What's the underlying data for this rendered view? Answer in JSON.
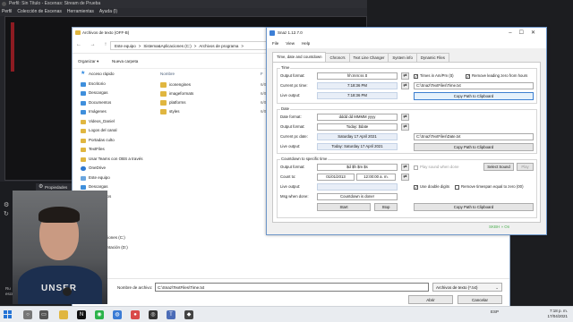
{
  "obs": {
    "title": "Perfil: Sin Título - Escenas: Stream de Prueba",
    "menu": [
      "Perfil",
      "Colección de Escenas",
      "Herramientas",
      "Ayuda (I)"
    ],
    "scene_bar_label": "Propiedades",
    "bottom_text": [
      "Ru",
      "escribir_..."
    ]
  },
  "webcam": {
    "shirt_text": "UNSER"
  },
  "explorer": {
    "title": "Archivos de texto (OFF-B)",
    "breadcrumb": [
      "Este equipo",
      ">",
      "Sistema&Aplicaciones (C:)",
      ">",
      "Archivos de programa",
      ">"
    ],
    "toolbar": {
      "organize": "Organizar ▾",
      "new_folder": "Nueva carpeta"
    },
    "sidebar": [
      {
        "label": "Acceso rápido",
        "icon": "star-icon"
      },
      {
        "label": "Escritorio",
        "icon": "folder-blue-icon"
      },
      {
        "label": "Descargas",
        "icon": "download-icon"
      },
      {
        "label": "Documentos",
        "icon": "document-icon"
      },
      {
        "label": "Imágenes",
        "icon": "image-icon"
      },
      {
        "label": "Videos_Daniel",
        "icon": "folder-icon"
      },
      {
        "label": "Logos del canal",
        "icon": "folder-icon"
      },
      {
        "label": "Portadas culto",
        "icon": "folder-icon"
      },
      {
        "label": "TextFiles",
        "icon": "folder-icon"
      },
      {
        "label": "Usar Teams con OBS a través",
        "icon": "folder-icon"
      },
      {
        "label": "OneDrive",
        "icon": "cloud-icon"
      },
      {
        "label": "Este equipo",
        "icon": "pc-icon"
      },
      {
        "label": "Descargas",
        "icon": "download-icon"
      },
      {
        "label": "Documentos",
        "icon": "document-icon"
      },
      {
        "label": "Escritorio",
        "icon": "folder-blue-icon"
      }
    ],
    "sidebar_lower": [
      {
        "label": "3D",
        "icon": "folder-icon"
      },
      {
        "label": "...&Aplicaciones (C:)",
        "icon": "drive-icon"
      },
      {
        "label": "...Documentación (D:)",
        "icon": "drive-icon"
      }
    ],
    "columns": {
      "name": "Nombre",
      "date": "F"
    },
    "files": [
      {
        "name": "iconengines",
        "date": "6/0"
      },
      {
        "name": "imageformats",
        "date": "6/0"
      },
      {
        "name": "platforms",
        "date": "6/0"
      },
      {
        "name": "styles",
        "date": "6/0"
      }
    ],
    "footer": {
      "filename_label": "Nombre de archivo:",
      "filename_value": "C:\\Snaz\\TextFiles\\Time.txt",
      "filetype": "Archivos de texto (*.txt)",
      "open": "Abrir",
      "cancel": "Cancelar"
    }
  },
  "snaz": {
    "title": "Snaz 1.12.7.0",
    "menu": [
      "File",
      "View",
      "Help"
    ],
    "tabs": [
      "Time, date and countdown",
      "Chrono's",
      "Text Line Changer",
      "System info",
      "Dynamic Files"
    ],
    "time": {
      "group": "Time",
      "output_format_label": "Output format:",
      "output_format": "hh:mm:ss tt",
      "current_label": "Current pc time:",
      "current": "7:18:36 PM",
      "live_label": "Live output:",
      "live": "7:18:36 PM",
      "chk_ampm": "Times in Am/Pm (tt)",
      "chk_zero": "Remove leading zero from hours",
      "path": "C:\\Snaz\\TextFiles\\Time.txt",
      "copy": "Copy Path to Clipboard"
    },
    "date": {
      "group": "Date",
      "date_format_label": "Date format:",
      "date_format": "dddd dd MMMM yyyy",
      "output_format_label": "Output format:",
      "output_format": "Today: $date",
      "current_label": "Current pc date:",
      "current": "Saturday 17 April 2021",
      "live_label": "Live output:",
      "live": "Today: Saturday 17 April 2021",
      "path": "C:\\Snaz\\TextFiles\\Date.txt",
      "copy": "Copy Path to Clipboard"
    },
    "countdown": {
      "group": "Countdown to specific time",
      "output_format_label": "Output format:",
      "output_format": "$d $h $m $s",
      "count_label": "Count to:",
      "count_date": "01/01/2013",
      "count_time": "12:00:00 a. m.",
      "live_label": "Live output:",
      "live": "",
      "msg_label": "Msg when done:",
      "msg": "Countdown is done!",
      "start": "Start",
      "stop": "Stop",
      "chk_sound": "Play sound when done",
      "select_sound": "Select Sound",
      "play": "Play",
      "chk_double": "Use double digits",
      "chk_remove": "Remove timespan equal to zero (00)",
      "copy": "Copy Path to Clipboard"
    },
    "status": "SKBH » On"
  },
  "taskbar": {
    "tray_lang": "ESP",
    "time": "7:18 p. m.",
    "date": "17/04/2021"
  }
}
